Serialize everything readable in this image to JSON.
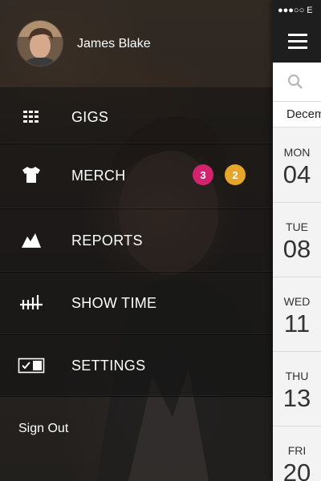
{
  "user": {
    "name": "James Blake"
  },
  "menu": {
    "items": [
      {
        "label": "GIGS",
        "icon": "grid-icon"
      },
      {
        "label": "MERCH",
        "icon": "tshirt-icon",
        "badges": [
          {
            "count": "3",
            "color": "#d3236f"
          },
          {
            "count": "2",
            "color": "#e6a52b"
          }
        ]
      },
      {
        "label": "REPORTS",
        "icon": "chart-mountain-icon"
      },
      {
        "label": "SHOW TIME",
        "icon": "tally-icon"
      },
      {
        "label": "SETTINGS",
        "icon": "checkbox-toggle-icon"
      }
    ],
    "sign_out": "Sign Out"
  },
  "status_bar": {
    "text": "●●●○○ E"
  },
  "calendar": {
    "month": "Decem",
    "days": [
      {
        "dow": "MON",
        "num": "04"
      },
      {
        "dow": "TUE",
        "num": "08"
      },
      {
        "dow": "WED",
        "num": "11"
      },
      {
        "dow": "THU",
        "num": "13"
      },
      {
        "dow": "FRI",
        "num": "20"
      }
    ]
  },
  "colors": {
    "badge_pink": "#d3236f",
    "badge_orange": "#e6a52b",
    "top_bar": "#1e1e1e"
  }
}
